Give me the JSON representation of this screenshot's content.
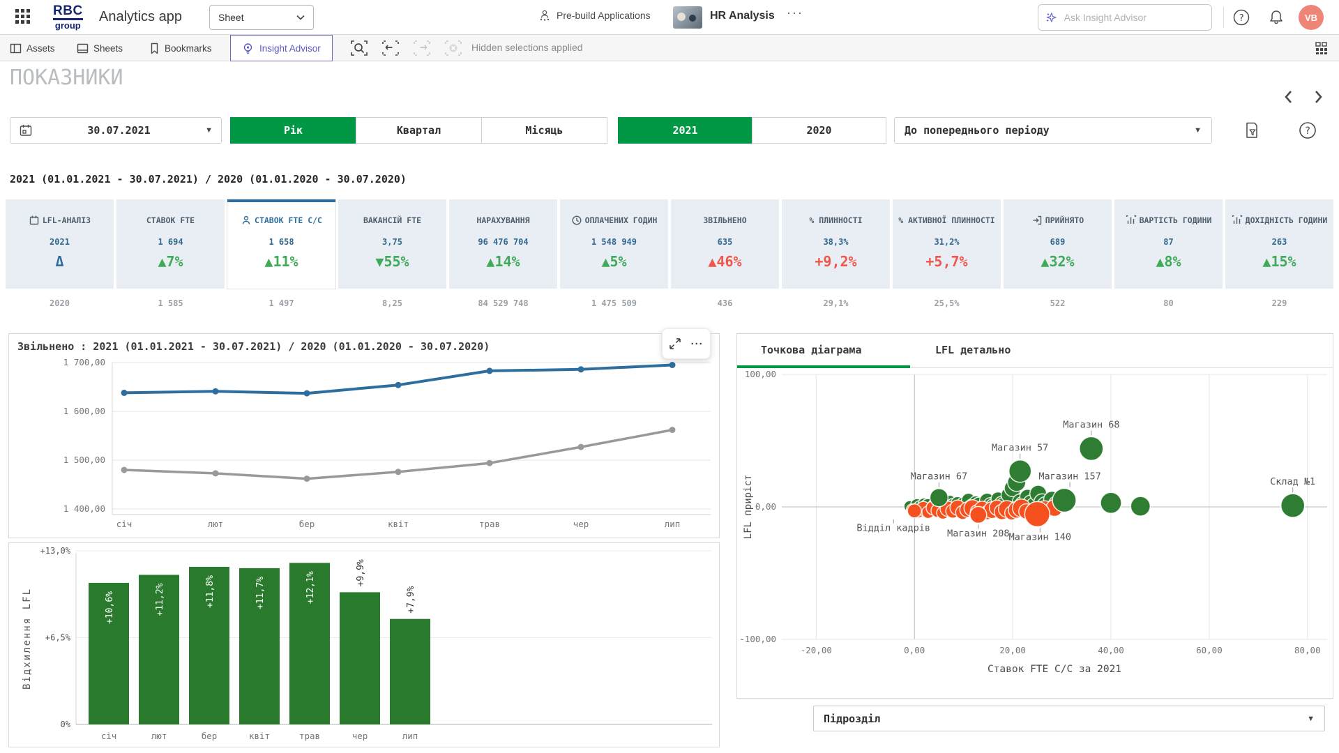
{
  "topbar": {
    "logo_line1": "RBC",
    "logo_line2": "group",
    "app_title": "Analytics app",
    "sheet_selector": "Sheet",
    "prebuild_label": "Pre-build Applications",
    "app_name": "HR Analysis",
    "ellipsis": "···",
    "search_placeholder": "Ask Insight Advisor",
    "avatar_initials": "VB"
  },
  "toolbar": {
    "assets": "Assets",
    "sheets": "Sheets",
    "bookmarks": "Bookmarks",
    "insight_advisor": "Insight Advisor",
    "hidden_selections": "Hidden selections applied"
  },
  "page": {
    "title": "ПОКАЗНИКИ",
    "selection_label": "2021 (01.01.2021 - 30.07.2021) / 2020 (01.01.2020 - 30.07.2020)"
  },
  "filters": {
    "date_value": "30.07.2021",
    "period_buttons": [
      {
        "label": "Рік",
        "selected": true
      },
      {
        "label": "Квартал",
        "selected": false
      },
      {
        "label": "Місяць",
        "selected": false
      }
    ],
    "year_buttons": [
      {
        "label": "2021",
        "selected": true
      },
      {
        "label": "2020",
        "selected": false
      }
    ],
    "compare_dropdown": "До попереднього періоду"
  },
  "kpis": [
    {
      "label": "LFL-АНАЛІЗ",
      "icon": "calendar",
      "value": "2021",
      "delta": "Δ",
      "delta_color": "blue",
      "prev": "2020",
      "selected": false
    },
    {
      "label": "СТАВОК FTE",
      "icon": "",
      "value": "1 694",
      "delta": "▲7%",
      "delta_color": "green",
      "prev": "1 585",
      "selected": false
    },
    {
      "label": "СТАВОК FTE С/С",
      "icon": "person",
      "value": "1 658",
      "delta": "▲11%",
      "delta_color": "green",
      "prev": "1 497",
      "selected": true
    },
    {
      "label": "ВАКАНСІЙ FTE",
      "icon": "",
      "value": "3,75",
      "delta": "▼55%",
      "delta_color": "green",
      "prev": "8,25",
      "selected": false
    },
    {
      "label": "НАРАХУВАННЯ",
      "icon": "",
      "value": "96 476 704",
      "delta": "▲14%",
      "delta_color": "green",
      "prev": "84 529 748",
      "selected": false
    },
    {
      "label": "ОПЛАЧЕНИХ ГОДИН",
      "icon": "clock",
      "value": "1 548 949",
      "delta": "▲5%",
      "delta_color": "green",
      "prev": "1 475 509",
      "selected": false
    },
    {
      "label": "ЗВІЛЬНЕНО",
      "icon": "",
      "value": "635",
      "delta": "▲46%",
      "delta_color": "red",
      "prev": "436",
      "selected": false
    },
    {
      "label": "% ПЛИННОСТІ",
      "icon": "",
      "value": "38,3%",
      "delta": "+9,2%",
      "delta_color": "red",
      "prev": "29,1%",
      "selected": false
    },
    {
      "label": "% АКТИВНОЇ ПЛИННОСТІ",
      "icon": "",
      "value": "31,2%",
      "delta": "+5,7%",
      "delta_color": "red",
      "prev": "25,5%",
      "selected": false
    },
    {
      "label": "ПРИЙНЯТО",
      "icon": "enter",
      "value": "689",
      "delta": "▲32%",
      "delta_color": "green",
      "prev": "522",
      "selected": false
    },
    {
      "label": "ВАРТІСТЬ ГОДИНИ",
      "icon": "bars",
      "value": "87",
      "delta": "▲8%",
      "delta_color": "green",
      "prev": "80",
      "selected": false
    },
    {
      "label": "ДОХІДНІСТЬ ГОДИНИ",
      "icon": "bars",
      "value": "263",
      "delta": "▲15%",
      "delta_color": "green",
      "prev": "229",
      "selected": false
    }
  ],
  "scatter_panel": {
    "tabs": [
      {
        "label": "Точкова діаграма",
        "active": true
      },
      {
        "label": "LFL детально",
        "active": false
      }
    ]
  },
  "bottom_dropdown": "Підрозділ",
  "colors": {
    "qlik_green": "#009845",
    "kpi_green": "#3faa58",
    "kpi_red": "#f0564a",
    "kpi_blue": "#33688f",
    "prev_gray": "#9aa0a6",
    "line_blue": "#2e6e9e",
    "line_gray": "#999999",
    "bar_green": "#2a7a2e",
    "scatter_green": "#2e7d32",
    "scatter_orange": "#f4511e",
    "avatar_salmon": "#ef8576",
    "insight_purple": "#5b5bc0"
  },
  "chart_data": [
    {
      "type": "line",
      "title": "Звільнено : 2021 (01.01.2021 - 30.07.2021) / 2020 (01.01.2020 - 30.07.2020)",
      "categories": [
        "січ",
        "лют",
        "бер",
        "квіт",
        "трав",
        "чер",
        "лип"
      ],
      "series": [
        {
          "name": "2021",
          "color": "#2e6e9e",
          "values": [
            1638,
            1641,
            1637,
            1654,
            1683,
            1686,
            1695
          ]
        },
        {
          "name": "2020",
          "color": "#999999",
          "values": [
            1480,
            1473,
            1462,
            1476,
            1494,
            1527,
            1562
          ]
        }
      ],
      "ylim": [
        1400,
        1700
      ],
      "yticks": [
        {
          "v": 1700,
          "label": "1 700,00"
        },
        {
          "v": 1600,
          "label": "1 600,00"
        },
        {
          "v": 1500,
          "label": "1 500,00"
        },
        {
          "v": 1400,
          "label": "1 400,00"
        }
      ],
      "grid": true,
      "legend": "none"
    },
    {
      "type": "bar",
      "title": "",
      "ylabel": "Відхилення LFL",
      "categories": [
        "січ",
        "лют",
        "бер",
        "квіт",
        "трав",
        "чер",
        "лип"
      ],
      "values": [
        10.6,
        11.2,
        11.8,
        11.7,
        12.1,
        9.9,
        7.9
      ],
      "bar_labels": [
        "+10,6%",
        "+11,2%",
        "+11,8%",
        "+11,7%",
        "+12,1%",
        "+9,9%",
        "+7,9%"
      ],
      "label_pos": [
        "in",
        "in",
        "in",
        "in",
        "in",
        "out",
        "out"
      ],
      "yticks": [
        {
          "v": 13,
          "label": "+13,0%"
        },
        {
          "v": 6.5,
          "label": "+6,5%"
        },
        {
          "v": 0,
          "label": "0%"
        }
      ],
      "ylim": [
        0,
        13.6
      ],
      "bar_color": "#2a7a2e"
    },
    {
      "type": "scatter",
      "title": "Точкова діаграма",
      "xlabel": "Ставок FTE С/С за 2021",
      "ylabel": "LFL приріст",
      "xlim": [
        -27,
        84
      ],
      "ylim": [
        -105,
        105
      ],
      "xticks": [
        {
          "v": -20,
          "label": "-20,00"
        },
        {
          "v": 0,
          "label": "0,00"
        },
        {
          "v": 20,
          "label": "20,00"
        },
        {
          "v": 40,
          "label": "40,00"
        },
        {
          "v": 60,
          "label": "60,00"
        },
        {
          "v": 80,
          "label": "80,00"
        }
      ],
      "yticks": [
        {
          "v": 100,
          "label": "100,00"
        },
        {
          "v": 0,
          "label": "0,00"
        },
        {
          "v": -100,
          "label": "-100,00"
        }
      ],
      "labeled_points": [
        {
          "name": "Магазин 68",
          "x": 36,
          "y": 44,
          "r": 17,
          "color": "green",
          "pos": "above",
          "dx": 0
        },
        {
          "name": "Магазин 57",
          "x": 21.5,
          "y": 27,
          "r": 16,
          "color": "green",
          "pos": "above",
          "dx": 0
        },
        {
          "name": "Магазин 67",
          "x": 5,
          "y": 7,
          "r": 13,
          "color": "green",
          "pos": "above",
          "dx": 0
        },
        {
          "name": "Магазин 157",
          "x": 30.5,
          "y": 5,
          "r": 17,
          "color": "green",
          "pos": "above",
          "dx": 8
        },
        {
          "name": "Склад №1",
          "x": 77,
          "y": 1,
          "r": 17,
          "color": "green",
          "pos": "above",
          "dx": 0
        },
        {
          "name": "Відділ кадрів",
          "x": 0,
          "y": -3,
          "r": 10,
          "color": "orange",
          "pos": "below",
          "dx": -30
        },
        {
          "name": "Магазин 208",
          "x": 13,
          "y": -6,
          "r": 12,
          "color": "orange",
          "pos": "below",
          "dx": 0
        },
        {
          "name": "Магазин 140",
          "x": 25,
          "y": -5.5,
          "r": 18,
          "color": "orange",
          "pos": "below",
          "dx": 4
        }
      ],
      "cluster": [
        [
          -1,
          0.5,
          8,
          1
        ],
        [
          0.5,
          1.5,
          9,
          1
        ],
        [
          1.2,
          -0.5,
          10,
          1
        ],
        [
          2,
          2,
          9,
          1
        ],
        [
          2.8,
          0.5,
          11,
          1
        ],
        [
          3.5,
          -1,
          9,
          1
        ],
        [
          4.2,
          1.2,
          10,
          1
        ],
        [
          5.8,
          -0.3,
          12,
          1
        ],
        [
          6.5,
          1.8,
          10,
          1
        ],
        [
          7.2,
          4,
          9,
          1
        ],
        [
          8,
          0.8,
          11,
          1
        ],
        [
          8.8,
          2.5,
          10,
          1
        ],
        [
          9.5,
          -0.8,
          9,
          1
        ],
        [
          10.2,
          1.5,
          12,
          1
        ],
        [
          11,
          5,
          10,
          1
        ],
        [
          11.8,
          0.3,
          11,
          1
        ],
        [
          12.5,
          3,
          10,
          1
        ],
        [
          13.2,
          1,
          12,
          1
        ],
        [
          14,
          -0.5,
          10,
          1
        ],
        [
          14.8,
          4.5,
          11,
          1
        ],
        [
          15.5,
          1.8,
          10,
          1
        ],
        [
          16.2,
          0.2,
          12,
          1
        ],
        [
          17,
          6,
          10,
          1
        ],
        [
          17.8,
          2.2,
          11,
          1
        ],
        [
          18.5,
          0.8,
          13,
          1
        ],
        [
          19.2,
          9,
          11,
          1
        ],
        [
          20,
          14,
          12,
          1
        ],
        [
          20.8,
          18.5,
          13,
          1
        ],
        [
          21.5,
          4,
          11,
          1
        ],
        [
          22.2,
          1.2,
          13,
          1
        ],
        [
          23,
          7.5,
          11,
          1
        ],
        [
          23.8,
          2.8,
          12,
          1
        ],
        [
          24.5,
          0.5,
          13,
          1
        ],
        [
          25.2,
          10,
          12,
          1
        ],
        [
          26,
          3.5,
          12,
          1
        ],
        [
          26.8,
          1,
          13,
          1
        ],
        [
          28,
          5.5,
          12,
          1
        ],
        [
          29,
          2,
          12,
          1
        ],
        [
          40,
          3,
          15,
          1
        ],
        [
          46,
          0.5,
          14,
          1
        ],
        [
          -0.5,
          -2,
          8,
          0
        ],
        [
          0.8,
          -3.5,
          9,
          0
        ],
        [
          1.8,
          -1.2,
          10,
          0
        ],
        [
          2.8,
          -4,
          9,
          0
        ],
        [
          3.8,
          -0.8,
          10,
          0
        ],
        [
          4.8,
          -2.8,
          10,
          0
        ],
        [
          5.8,
          -4.5,
          9,
          0
        ],
        [
          6.8,
          -1.5,
          11,
          0
        ],
        [
          7.8,
          -3.2,
          10,
          0
        ],
        [
          8.8,
          -0.6,
          11,
          0
        ],
        [
          9.8,
          -4.2,
          10,
          0
        ],
        [
          10.8,
          -2,
          11,
          0
        ],
        [
          11.8,
          -0.9,
          12,
          0
        ],
        [
          12.8,
          -3.6,
          10,
          0
        ],
        [
          13.8,
          -1.4,
          11,
          0
        ],
        [
          14.8,
          -4.4,
          10,
          0
        ],
        [
          15.8,
          -2.4,
          12,
          0
        ],
        [
          16.8,
          -0.7,
          11,
          0
        ],
        [
          17.8,
          -3.8,
          11,
          0
        ],
        [
          18.8,
          -1.6,
          12,
          0
        ],
        [
          19.8,
          -4.6,
          10,
          0
        ],
        [
          20.8,
          -2.2,
          12,
          0
        ],
        [
          21.8,
          -0.9,
          13,
          0
        ],
        [
          22.8,
          -3.4,
          11,
          0
        ],
        [
          26.5,
          -2.2,
          13,
          0
        ],
        [
          28.5,
          -0.8,
          12,
          0
        ]
      ]
    }
  ]
}
